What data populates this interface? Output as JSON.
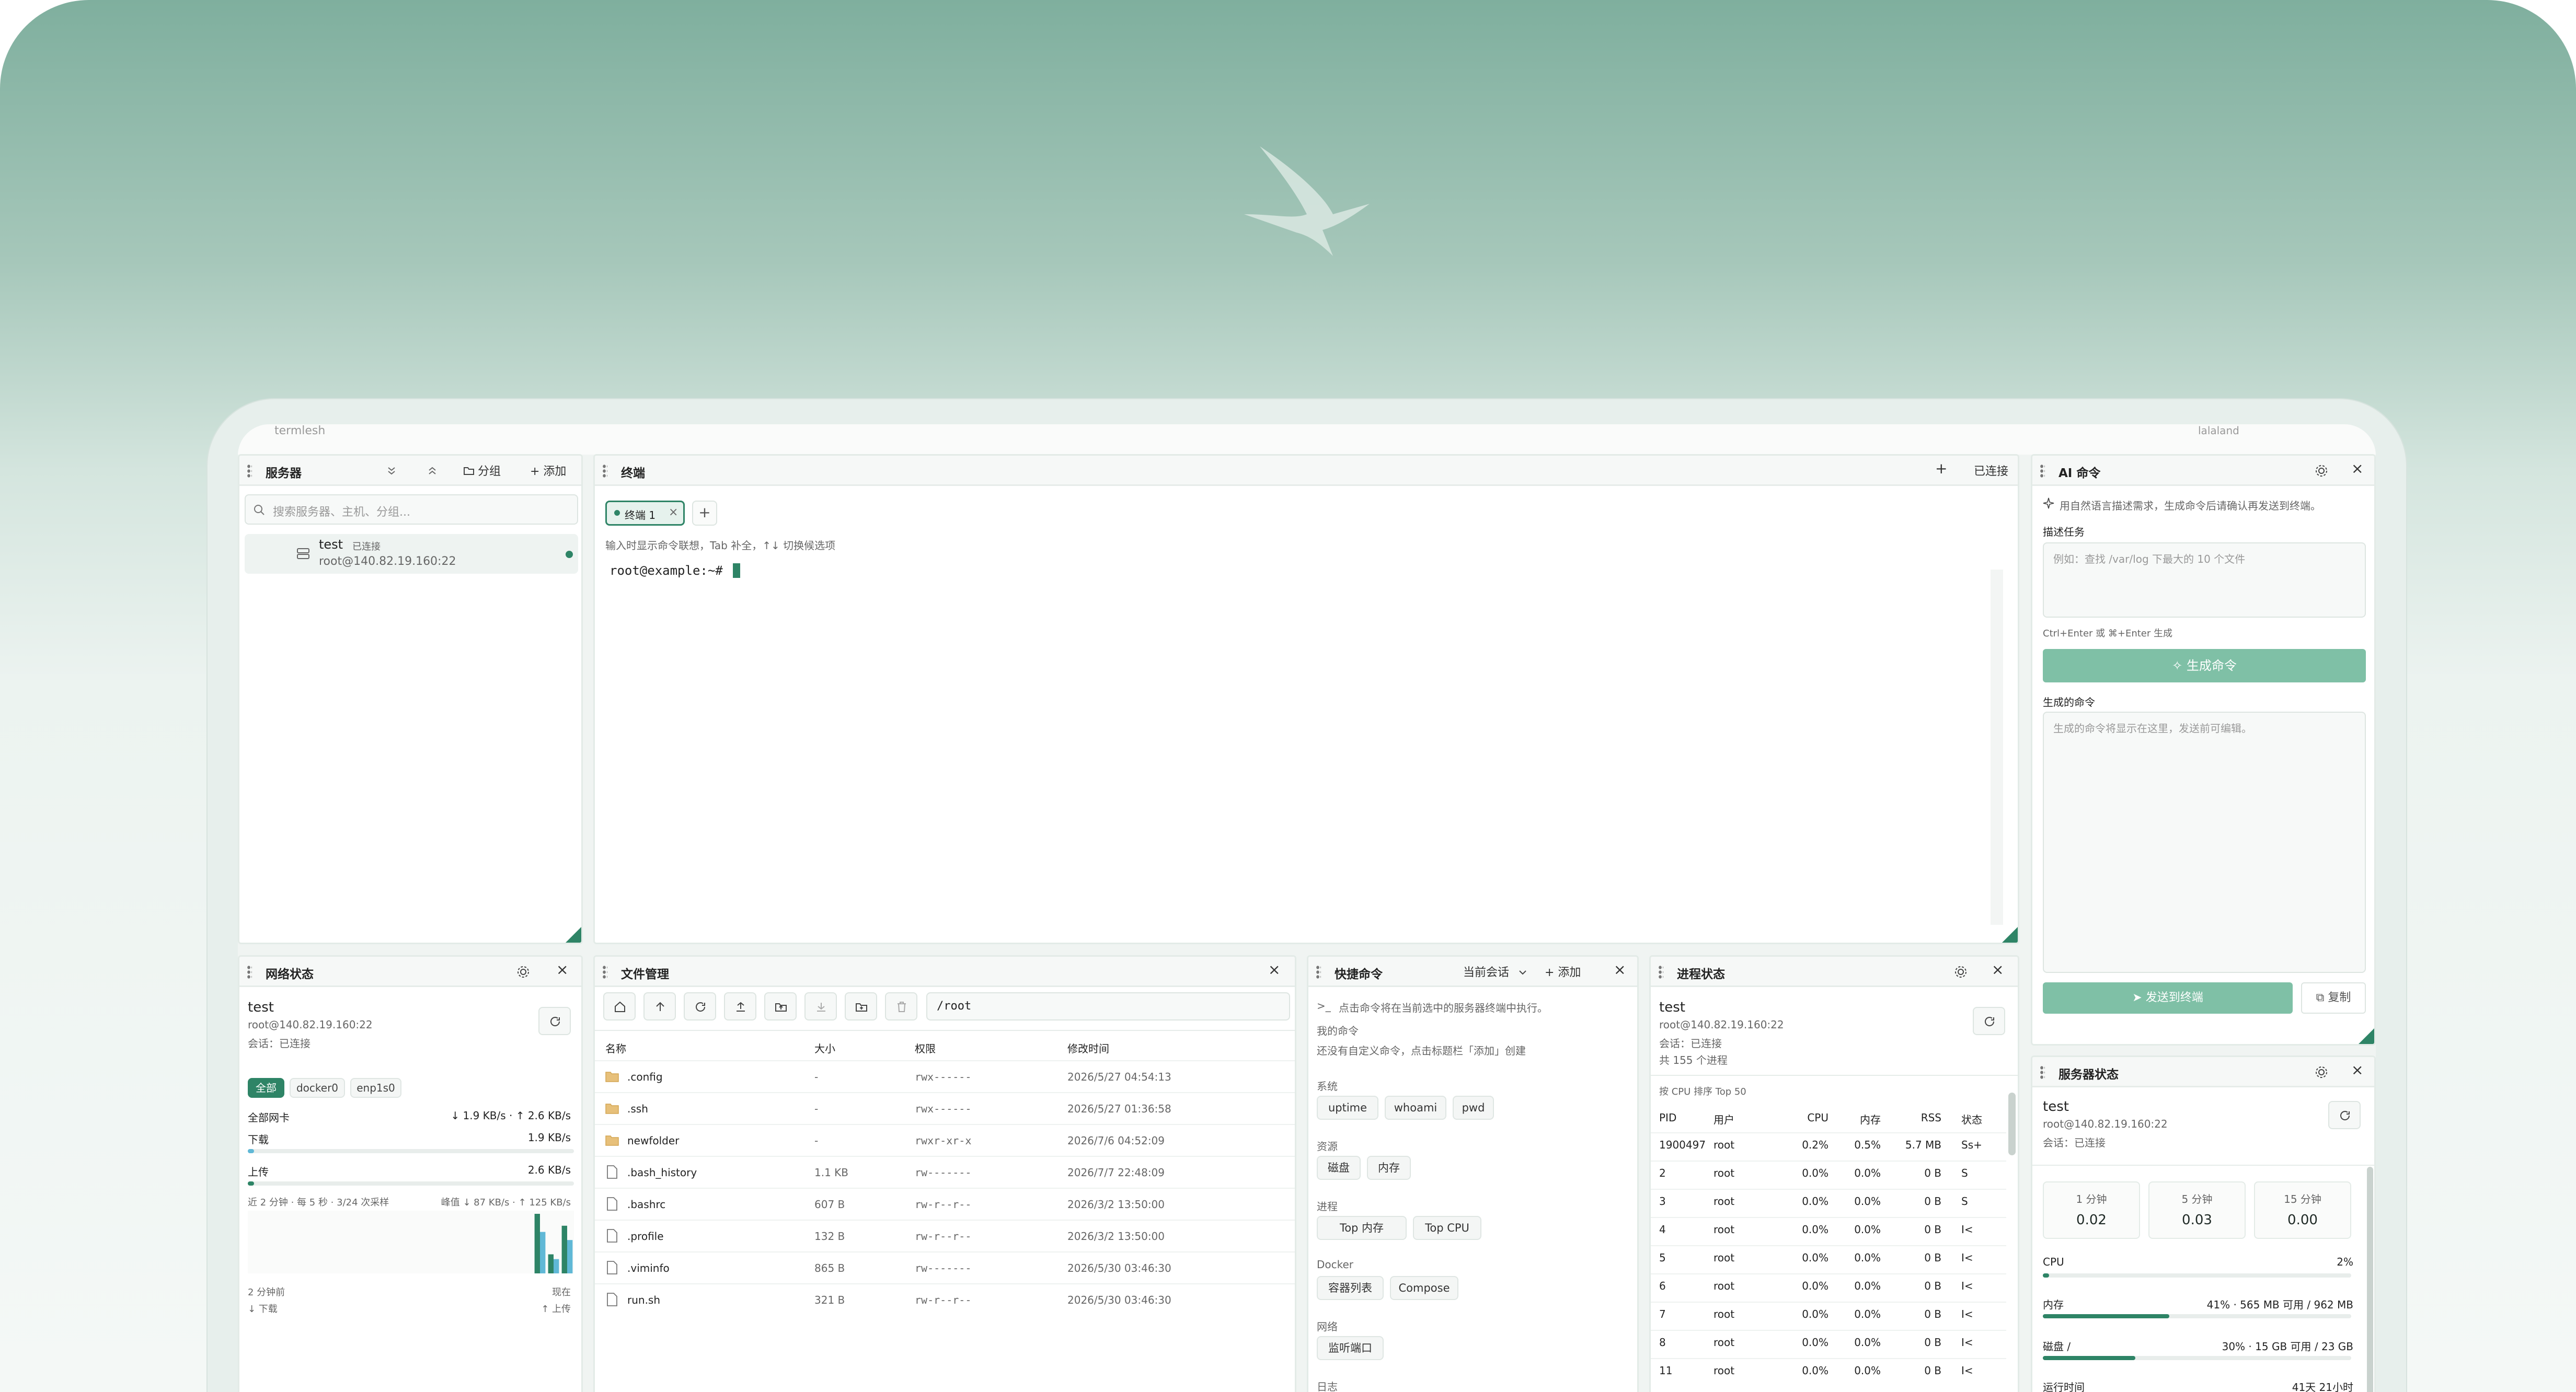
{
  "app": {
    "title": "termlesh",
    "user": "lalaland"
  },
  "colors": {
    "accent": "#2e8466",
    "accent_light": "#7fc0a6",
    "bg_top": "#7faf9e"
  },
  "servers": {
    "title": "服务器",
    "group_label": "分组",
    "add_label": "+ 添加",
    "search_placeholder": "搜索服务器、主机、分组...",
    "items": [
      {
        "name": "test",
        "status": "已连接",
        "address": "root@140.82.19.160:22"
      }
    ]
  },
  "terminal": {
    "title": "终端",
    "status": "已连接",
    "tab_label": "终端 1",
    "hint": "输入时显示命令联想，Tab 补全，↑↓ 切换候选项",
    "prompt": "root@example:~#"
  },
  "ai": {
    "title": "AI 命令",
    "intro": "用自然语言描述需求，生成命令后请确认再发送到终端。",
    "task_label": "描述任务",
    "task_placeholder": "例如：查找 /var/log 下最大的 10 个文件",
    "shortcut": "Ctrl+Enter 或 ⌘+Enter 生成",
    "generate_button": "生成命令",
    "generated_label": "生成的命令",
    "generated_placeholder": "生成的命令将显示在这里，发送前可编辑。",
    "send_button": "发送到终端",
    "copy_button": "复制"
  },
  "network": {
    "title": "网络状态",
    "server": "test",
    "address": "root@140.82.19.160:22",
    "session": "会话：已连接",
    "tabs": [
      "全部",
      "docker0",
      "enp1s0"
    ],
    "all_nics_label": "全部网卡",
    "all_nics_value": "↓ 1.9 KB/s · ↑ 2.6 KB/s",
    "down_label": "下载",
    "down_value": "1.9 KB/s",
    "down_fraction": 0.02,
    "up_label": "上传",
    "up_value": "2.6 KB/s",
    "up_fraction": 0.02,
    "sample_info": "近 2 分钟 · 每 5 秒 · 3/24 次采样",
    "peak_info": "峰值 ↓ 87 KB/s · ↑ 125 KB/s",
    "time_start": "2 分钟前",
    "time_end": "现在",
    "legend_down": "↓ 下载",
    "legend_up": "↑ 上传",
    "samples_down": [
      0,
      0,
      0,
      0,
      0,
      0,
      0,
      0,
      0,
      0,
      0,
      0,
      0,
      0,
      0,
      0,
      0,
      0,
      0,
      0,
      0,
      87,
      30,
      70
    ],
    "samples_up": [
      0,
      0,
      0,
      0,
      0,
      0,
      0,
      0,
      0,
      0,
      0,
      0,
      0,
      0,
      0,
      0,
      0,
      0,
      0,
      0,
      0,
      125,
      40,
      100
    ]
  },
  "files": {
    "title": "文件管理",
    "path": "/root",
    "columns": [
      "名称",
      "大小",
      "权限",
      "修改时间"
    ],
    "rows": [
      {
        "name": ".config",
        "size": "-",
        "perm": "rwx------",
        "mtime": "2026/5/27 04:54:13",
        "type": "folder"
      },
      {
        "name": ".ssh",
        "size": "-",
        "perm": "rwx------",
        "mtime": "2026/5/27 01:36:58",
        "type": "folder"
      },
      {
        "name": "newfolder",
        "size": "-",
        "perm": "rwxr-xr-x",
        "mtime": "2026/7/6 04:52:09",
        "type": "folder"
      },
      {
        "name": ".bash_history",
        "size": "1.1 KB",
        "perm": "rw-------",
        "mtime": "2026/7/7 22:48:09",
        "type": "file"
      },
      {
        "name": ".bashrc",
        "size": "607 B",
        "perm": "rw-r--r--",
        "mtime": "2026/3/2 13:50:00",
        "type": "file"
      },
      {
        "name": ".profile",
        "size": "132 B",
        "perm": "rw-r--r--",
        "mtime": "2026/3/2 13:50:00",
        "type": "file"
      },
      {
        "name": ".viminfo",
        "size": "865 B",
        "perm": "rw-------",
        "mtime": "2026/5/30 03:46:30",
        "type": "file"
      },
      {
        "name": "run.sh",
        "size": "321 B",
        "perm": "rw-r--r--",
        "mtime": "2026/5/30 03:46:30",
        "type": "file"
      }
    ]
  },
  "quick": {
    "title": "快捷命令",
    "scope": "当前会话",
    "add_label": "+ 添加",
    "hint": "点击命令将在当前选中的服务器终端中执行。",
    "my_label": "我的命令",
    "empty": "还没有自定义命令，点击标题栏「添加」创建",
    "groups": [
      {
        "label": "系统",
        "items": [
          "uptime",
          "whoami",
          "pwd"
        ]
      },
      {
        "label": "资源",
        "items": [
          "磁盘",
          "内存"
        ]
      },
      {
        "label": "进程",
        "items": [
          "Top 内存",
          "Top CPU"
        ]
      },
      {
        "label": "Docker",
        "items": [
          "容器列表",
          "Compose"
        ]
      },
      {
        "label": "网络",
        "items": [
          "监听端口"
        ]
      },
      {
        "label": "日志",
        "items": []
      }
    ]
  },
  "process": {
    "title": "进程状态",
    "server": "test",
    "address": "root@140.82.19.160:22",
    "session": "会话：已连接",
    "count": "共 155 个进程",
    "sort_info": "按 CPU 排序 Top 50",
    "columns": [
      "PID",
      "用户",
      "CPU",
      "内存",
      "RSS",
      "状态"
    ],
    "rows": [
      [
        "1900497",
        "root",
        "0.2%",
        "0.5%",
        "5.7 MB",
        "Ss+"
      ],
      [
        "2",
        "root",
        "0.0%",
        "0.0%",
        "0 B",
        "S"
      ],
      [
        "3",
        "root",
        "0.0%",
        "0.0%",
        "0 B",
        "S"
      ],
      [
        "4",
        "root",
        "0.0%",
        "0.0%",
        "0 B",
        "I<"
      ],
      [
        "5",
        "root",
        "0.0%",
        "0.0%",
        "0 B",
        "I<"
      ],
      [
        "6",
        "root",
        "0.0%",
        "0.0%",
        "0 B",
        "I<"
      ],
      [
        "7",
        "root",
        "0.0%",
        "0.0%",
        "0 B",
        "I<"
      ],
      [
        "8",
        "root",
        "0.0%",
        "0.0%",
        "0 B",
        "I<"
      ],
      [
        "11",
        "root",
        "0.0%",
        "0.0%",
        "0 B",
        "I<"
      ]
    ]
  },
  "status": {
    "title": "服务器状态",
    "server": "test",
    "address": "root@140.82.19.160:22",
    "session": "会话：已连接",
    "loads": [
      {
        "label": "1 分钟",
        "value": "0.02"
      },
      {
        "label": "5 分钟",
        "value": "0.03"
      },
      {
        "label": "15 分钟",
        "value": "0.00"
      }
    ],
    "cpu_label": "CPU",
    "cpu_value": "2%",
    "cpu_fraction": 0.02,
    "mem_label": "内存",
    "mem_value": "41% · 565 MB 可用 / 962 MB",
    "mem_fraction": 0.41,
    "disk_label": "磁盘 /",
    "disk_value": "30% · 15 GB 可用 / 23 GB",
    "disk_fraction": 0.3,
    "uptime_label": "运行时间",
    "uptime_value": "41天 21小时"
  }
}
